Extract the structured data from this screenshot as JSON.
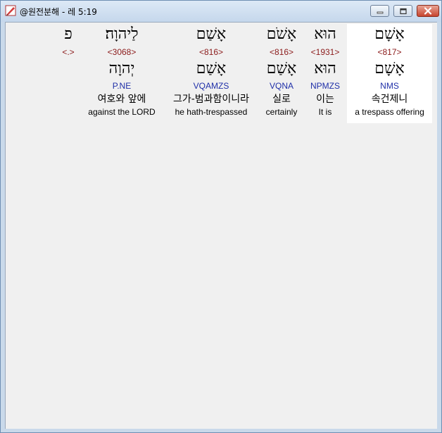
{
  "window": {
    "title": "@원전분해 - 레 5:19",
    "icon": "quill-pen-icon"
  },
  "words": [
    {
      "hebrew": "אָשָׁם",
      "strong": "<817>",
      "lexeme": "אָשָׁם",
      "morph": "NMS",
      "korean": "속건제니",
      "english": "a trespass offering",
      "selected": true
    },
    {
      "hebrew": "הוּא",
      "strong": "<1931>",
      "lexeme": "הוּא",
      "morph": "NPMZS",
      "korean": "이는",
      "english": "It is",
      "selected": false
    },
    {
      "hebrew": "אָשֹׁם",
      "strong": "<816>",
      "lexeme": "אָשַׁם",
      "morph": "VQNA",
      "korean": "실로",
      "english": "certainly",
      "selected": false
    },
    {
      "hebrew": "אָשַׁם",
      "strong": "<816>",
      "lexeme": "אָשַׁם",
      "morph": "VQAMZS",
      "korean": "그가-범과함이니라",
      "english": "he hath-trespassed",
      "selected": false
    },
    {
      "hebrew": "לַיהוָה׃",
      "strong": "<3068>",
      "lexeme": "יְהוָה",
      "morph": "P.NE",
      "korean": "여호와 앞에",
      "english": "against the LORD",
      "selected": false
    },
    {
      "hebrew": "פ",
      "strong": "<.>",
      "lexeme": "",
      "morph": "",
      "korean": "",
      "english": "",
      "selected": false
    }
  ]
}
